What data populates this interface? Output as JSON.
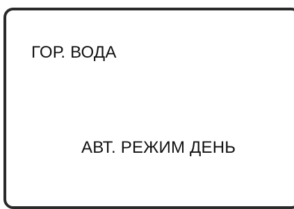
{
  "display": {
    "line1": "ГОР. ВОДА",
    "line2": "АВТ. РЕЖИМ ДЕНЬ"
  }
}
